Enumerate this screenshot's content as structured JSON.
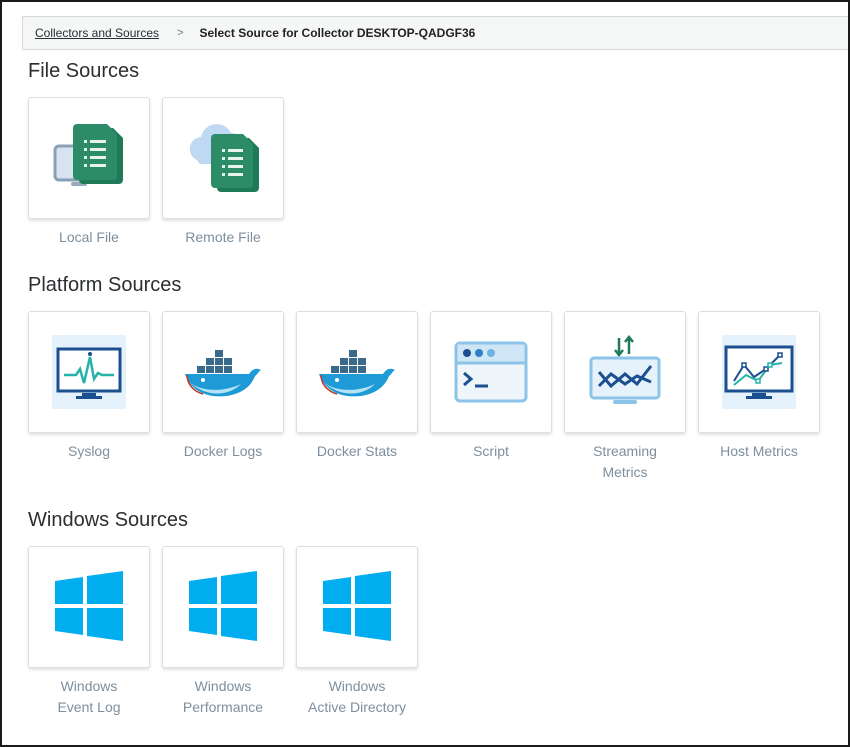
{
  "breadcrumb": {
    "parent": "Collectors and Sources",
    "separator": ">",
    "current": "Select Source for Collector DESKTOP-QADGF36"
  },
  "sections": {
    "file": {
      "title": "File Sources",
      "tiles": [
        {
          "label": "Local File",
          "icon": "local-file-icon"
        },
        {
          "label": "Remote File",
          "icon": "remote-file-icon"
        }
      ]
    },
    "platform": {
      "title": "Platform Sources",
      "tiles": [
        {
          "label": "Syslog",
          "icon": "syslog-monitor-icon"
        },
        {
          "label": "Docker Logs",
          "icon": "docker-whale-icon"
        },
        {
          "label": "Docker Stats",
          "icon": "docker-whale-icon"
        },
        {
          "label": "Script",
          "icon": "terminal-window-icon"
        },
        {
          "label": "Streaming\nMetrics",
          "icon": "streaming-metrics-icon"
        },
        {
          "label": "Host Metrics",
          "icon": "host-metrics-chart-icon"
        }
      ]
    },
    "windows": {
      "title": "Windows Sources",
      "tiles": [
        {
          "label": "Windows\nEvent Log",
          "icon": "windows-logo-icon"
        },
        {
          "label": "Windows\nPerformance",
          "icon": "windows-logo-icon"
        },
        {
          "label": "Windows\nActive Directory",
          "icon": "windows-logo-icon"
        }
      ]
    }
  },
  "colors": {
    "file_green": "#1f7a5a",
    "monitor_blue": "#1b4f8f",
    "docker_blue": "#2496ed",
    "windows_blue": "#00adef",
    "label_gray": "#7c8f9e"
  }
}
